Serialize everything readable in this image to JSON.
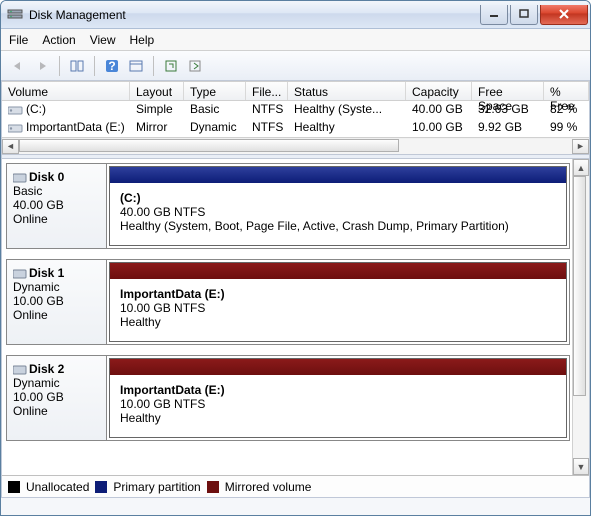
{
  "window": {
    "title": "Disk Management"
  },
  "menu": {
    "file": "File",
    "action": "Action",
    "view": "View",
    "help": "Help"
  },
  "vol_headers": {
    "volume": "Volume",
    "layout": "Layout",
    "type": "Type",
    "fs": "File...",
    "status": "Status",
    "capacity": "Capacity",
    "free": "Free Space",
    "pct": "% Free"
  },
  "volumes": [
    {
      "name": "(C:)",
      "layout": "Simple",
      "type": "Basic",
      "fs": "NTFS",
      "status": "Healthy (Syste...",
      "capacity": "40.00 GB",
      "free": "32.63 GB",
      "pct": "82 %"
    },
    {
      "name": "ImportantData (E:)",
      "layout": "Mirror",
      "type": "Dynamic",
      "fs": "NTFS",
      "status": "Healthy",
      "capacity": "10.00 GB",
      "free": "9.92 GB",
      "pct": "99 %"
    }
  ],
  "disks": [
    {
      "name": "Disk 0",
      "kind": "Basic",
      "size": "40.00 GB",
      "state": "Online",
      "bar": "blue",
      "part_name": "(C:)",
      "part_size": "40.00 GB NTFS",
      "part_status": "Healthy (System, Boot, Page File, Active, Crash Dump, Primary Partition)"
    },
    {
      "name": "Disk 1",
      "kind": "Dynamic",
      "size": "10.00 GB",
      "state": "Online",
      "bar": "maroon",
      "part_name": "ImportantData  (E:)",
      "part_size": "10.00 GB NTFS",
      "part_status": "Healthy"
    },
    {
      "name": "Disk 2",
      "kind": "Dynamic",
      "size": "10.00 GB",
      "state": "Online",
      "bar": "maroon",
      "part_name": "ImportantData  (E:)",
      "part_size": "10.00 GB NTFS",
      "part_status": "Healthy"
    }
  ],
  "legend": {
    "unalloc": "Unallocated",
    "primary": "Primary partition",
    "mirror": "Mirrored volume"
  }
}
